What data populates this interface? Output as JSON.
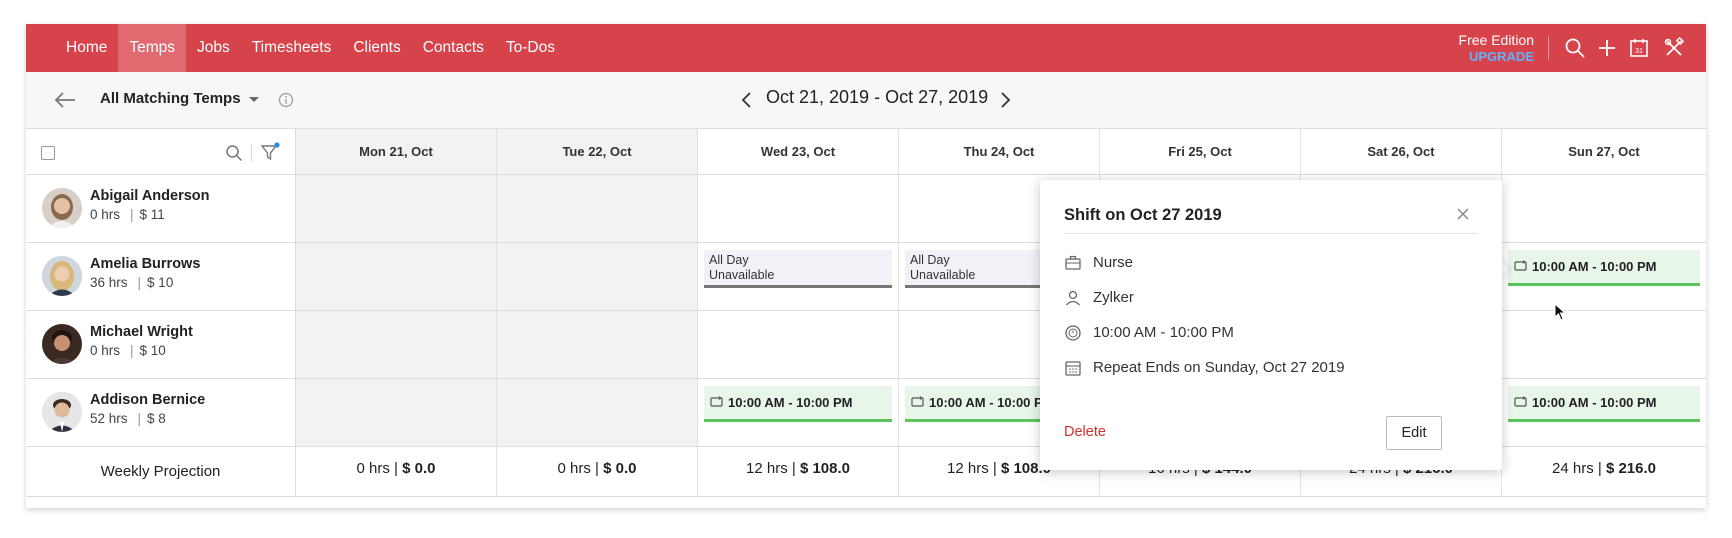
{
  "nav": {
    "tabs": [
      "Home",
      "Temps",
      "Jobs",
      "Timesheets",
      "Clients",
      "Contacts",
      "To-Dos"
    ],
    "active_tab": "Temps",
    "edition_label": "Free Edition",
    "upgrade_label": "UPGRADE",
    "icons": [
      "search-icon",
      "plus-icon",
      "calendar-icon",
      "tools-icon"
    ]
  },
  "subheader": {
    "filter_label": "All Matching Temps",
    "date_range": "Oct 21, 2019 - Oct 27, 2019"
  },
  "days": [
    {
      "label": "Mon 21, Oct",
      "shaded": true
    },
    {
      "label": "Tue 22, Oct",
      "shaded": true
    },
    {
      "label": "Wed 23, Oct",
      "shaded": false
    },
    {
      "label": "Thu 24, Oct",
      "shaded": false
    },
    {
      "label": "Fri 25, Oct",
      "shaded": false
    },
    {
      "label": "Sat 26, Oct",
      "shaded": false
    },
    {
      "label": "Sun 27, Oct",
      "shaded": false
    }
  ],
  "temps": [
    {
      "name": "Abigail Anderson",
      "hours": "0 hrs",
      "rate": "$ 11"
    },
    {
      "name": "Amelia Burrows",
      "hours": "36 hrs",
      "rate": "$ 10"
    },
    {
      "name": "Michael Wright",
      "hours": "0 hrs",
      "rate": "$ 10"
    },
    {
      "name": "Addison Bernice",
      "hours": "52 hrs",
      "rate": "$ 8"
    }
  ],
  "unavailable": {
    "line1": "All Day",
    "line2": "Unavailable"
  },
  "shift_time": "10:00 AM - 10:00 PM",
  "projection": {
    "label": "Weekly Projection",
    "hours": [
      "0 hrs | ",
      "0 hrs | ",
      "12 hrs | ",
      "12 hrs | ",
      "16 hrs | ",
      "24 hrs | ",
      "24 hrs | "
    ],
    "amounts": [
      "$ 0.0",
      "$ 0.0",
      "$ 108.0",
      "$ 108.0",
      "$ 144.0",
      "$ 216.0",
      "$ 216.0"
    ]
  },
  "popup": {
    "title": "Shift on Oct 27 2019",
    "job": "Nurse",
    "client": "Zylker",
    "time": "10:00 AM - 10:00 PM",
    "repeat": "Repeat Ends on Sunday, Oct 27 2019",
    "delete_label": "Delete",
    "edit_label": "Edit"
  },
  "colors": {
    "brand": "#d6434b",
    "active_tab": "#e06a70",
    "upgrade": "#5fb3ff",
    "shift_bar": "#5cc45c",
    "delete": "#d0312d"
  }
}
